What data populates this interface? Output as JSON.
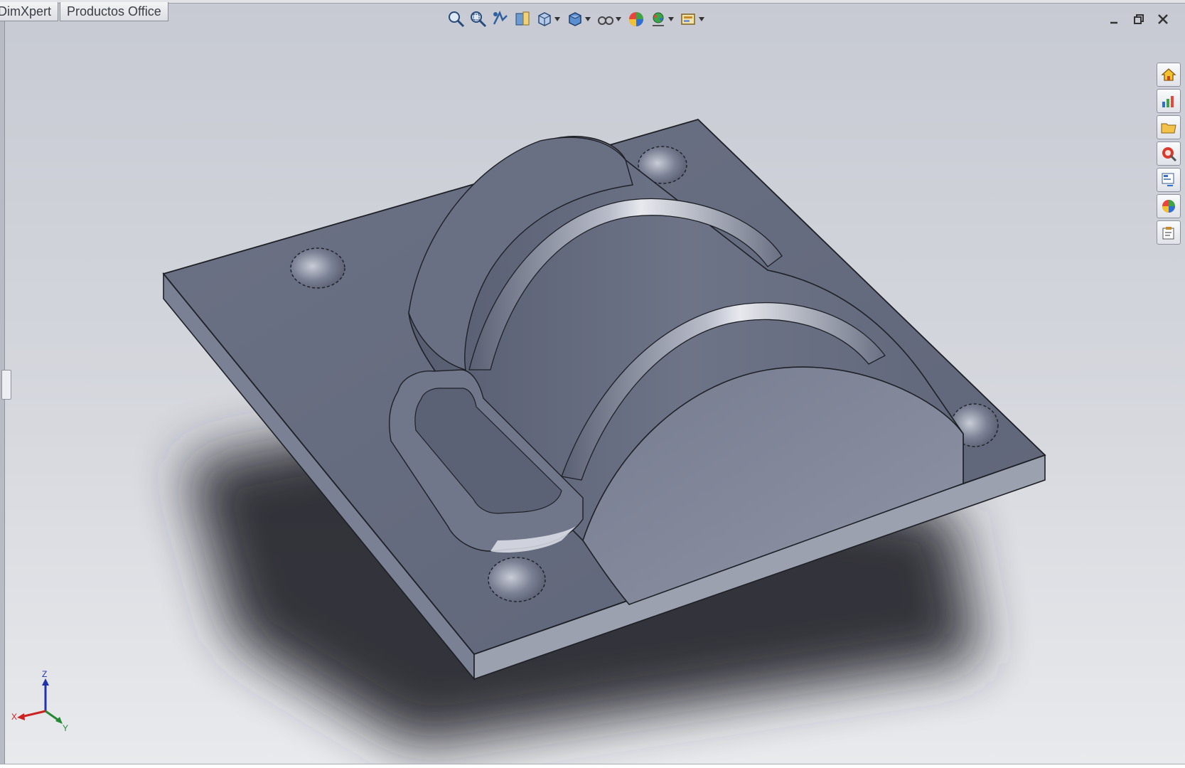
{
  "app": {
    "tabs": [
      {
        "label": "DimXpert"
      },
      {
        "label": "Productos Office"
      }
    ]
  },
  "heads_up_toolbar": {
    "buttons": [
      {
        "icon": "zoom-to-fit-icon",
        "dropdown": false
      },
      {
        "icon": "zoom-to-area-icon",
        "dropdown": false
      },
      {
        "icon": "previous-view-icon",
        "dropdown": false
      },
      {
        "icon": "section-view-icon",
        "dropdown": false
      },
      {
        "icon": "view-orientation-icon",
        "dropdown": true
      },
      {
        "icon": "display-style-icon",
        "dropdown": true
      },
      {
        "icon": "hide-show-items-icon",
        "dropdown": true
      },
      {
        "icon": "edit-appearance-icon",
        "dropdown": false
      },
      {
        "icon": "apply-scene-icon",
        "dropdown": true
      },
      {
        "icon": "view-settings-icon",
        "dropdown": true
      }
    ]
  },
  "window_controls": [
    "minimize-icon",
    "restore-icon",
    "close-icon"
  ],
  "task_pane": [
    {
      "icon": "home-icon"
    },
    {
      "icon": "resources-icon"
    },
    {
      "icon": "folder-icon"
    },
    {
      "icon": "search-icon"
    },
    {
      "icon": "file-explorer-icon"
    },
    {
      "icon": "appearances-icon"
    },
    {
      "icon": "custom-properties-icon"
    }
  ],
  "triad": {
    "x_label": "X",
    "y_label": "Y",
    "z_label": "Z"
  },
  "colors": {
    "background_top": "#c7cad3",
    "background_bottom": "#e9eaed",
    "part_top": "#6c7285",
    "part_side": "#8a90a1",
    "shadow": "#2a2b30",
    "edge": "#1e2026"
  }
}
